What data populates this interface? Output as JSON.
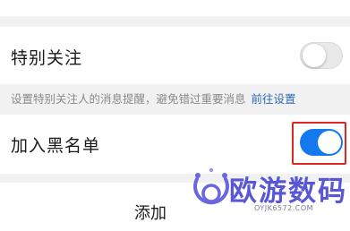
{
  "special_follow": {
    "label": "特别关注",
    "enabled": false
  },
  "hint": {
    "text": "设置特别关注人的消息提醒，避免错过重要消息",
    "link": "前往设置"
  },
  "blacklist": {
    "label": "加入黑名单",
    "enabled": true
  },
  "add": {
    "label": "添加"
  },
  "watermark": {
    "title": "欧游数码",
    "url": "OYJK6572.COM"
  },
  "colors": {
    "accent": "#1478ee",
    "link": "#2f6bb5",
    "highlight": "#e0271f",
    "watermark": "#5a57d6"
  }
}
